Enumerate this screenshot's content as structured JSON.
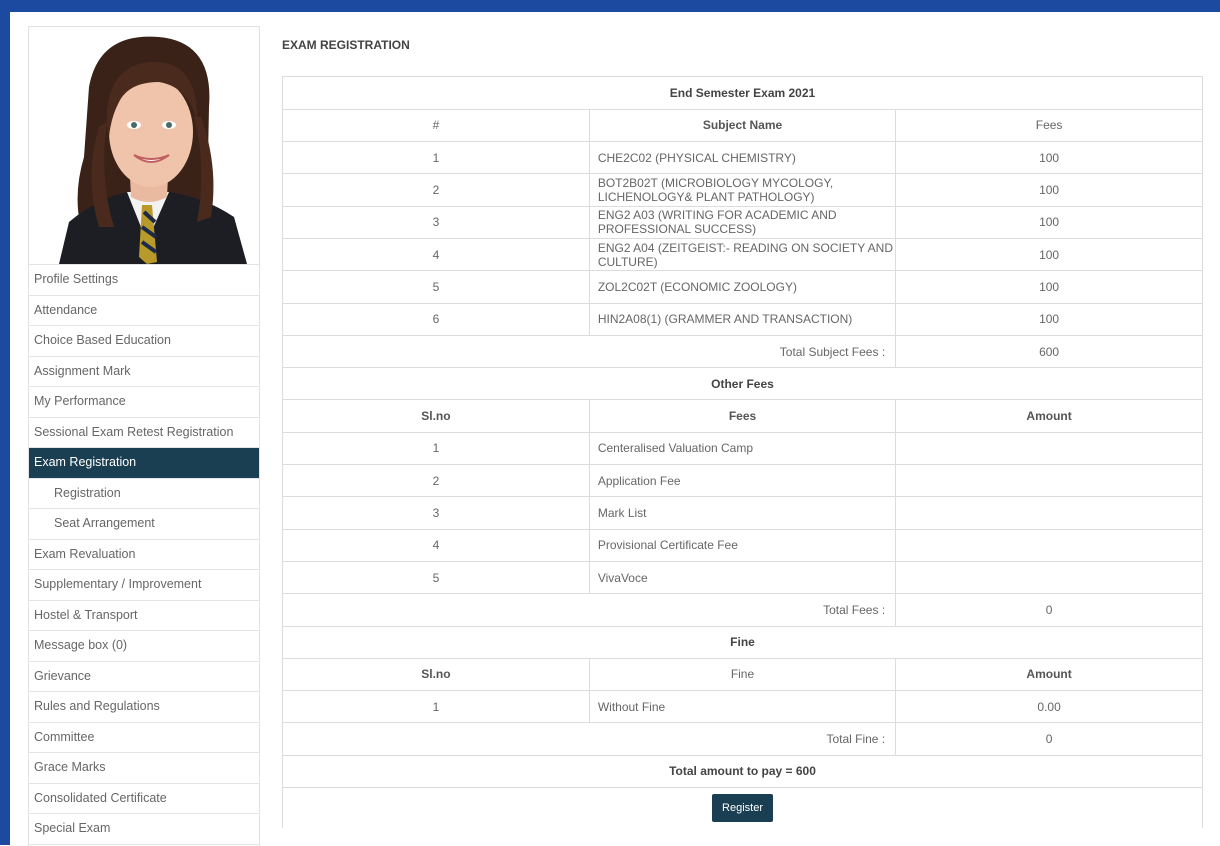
{
  "sidebar": {
    "menu": [
      {
        "label": "Profile Settings"
      },
      {
        "label": "Attendance"
      },
      {
        "label": "Choice Based Education"
      },
      {
        "label": "Assignment Mark"
      },
      {
        "label": "My Performance"
      },
      {
        "label": "Sessional Exam Retest Registration"
      },
      {
        "label": "Exam Registration"
      },
      {
        "label": "Registration"
      },
      {
        "label": "Seat Arrangement"
      },
      {
        "label": "Exam Revaluation"
      },
      {
        "label": "Supplementary / Improvement"
      },
      {
        "label": "Hostel & Transport"
      },
      {
        "label": "Message box (0)"
      },
      {
        "label": "Grievance"
      },
      {
        "label": "Rules and Regulations"
      },
      {
        "label": "Committee"
      },
      {
        "label": "Grace Marks"
      },
      {
        "label": "Consolidated Certificate"
      },
      {
        "label": "Special Exam"
      }
    ],
    "active_index": 6
  },
  "page": {
    "title": "EXAM REGISTRATION"
  },
  "exam": {
    "title": "End Semester Exam 2021",
    "headers": {
      "num": "#",
      "subject": "Subject Name",
      "fees": "Fees"
    },
    "subjects": [
      {
        "num": "1",
        "name": "CHE2C02  (PHYSICAL CHEMISTRY)",
        "fee": "100"
      },
      {
        "num": "2",
        "name": "BOT2B02T  (MICROBIOLOGY MYCOLOGY, LICHENOLOGY& PLANT PATHOLOGY)",
        "fee": "100"
      },
      {
        "num": "3",
        "name": "ENG2 A03  (WRITING FOR ACADEMIC AND PROFESSIONAL SUCCESS)",
        "fee": "100"
      },
      {
        "num": "4",
        "name": "ENG2 A04  (ZEITGEIST:- READING ON SOCIETY AND CULTURE)",
        "fee": "100"
      },
      {
        "num": "5",
        "name": "ZOL2C02T  (ECONOMIC ZOOLOGY)",
        "fee": "100"
      },
      {
        "num": "6",
        "name": "HIN2A08(1)  (GRAMMER AND TRANSACTION)",
        "fee": "100"
      }
    ],
    "total_subject_label": "Total Subject Fees :",
    "total_subject_value": "600"
  },
  "other_fees": {
    "title": "Other Fees",
    "headers": {
      "num": "Sl.no",
      "fees": "Fees",
      "amount": "Amount"
    },
    "rows": [
      {
        "num": "1",
        "name": "Centeralised Valuation Camp",
        "amount": ""
      },
      {
        "num": "2",
        "name": "Application Fee",
        "amount": ""
      },
      {
        "num": "3",
        "name": "Mark List",
        "amount": ""
      },
      {
        "num": "4",
        "name": "Provisional Certificate Fee",
        "amount": ""
      },
      {
        "num": "5",
        "name": "VivaVoce",
        "amount": ""
      }
    ],
    "total_label": "Total Fees :",
    "total_value": "0"
  },
  "fine": {
    "title": "Fine",
    "headers": {
      "num": "Sl.no",
      "fine": "Fine",
      "amount": "Amount"
    },
    "rows": [
      {
        "num": "1",
        "name": "Without Fine",
        "amount": "0.00"
      }
    ],
    "total_label": "Total Fine :",
    "total_value": "0"
  },
  "summary": {
    "total_label": "Total amount to pay = 600"
  },
  "actions": {
    "register_label": "Register"
  }
}
